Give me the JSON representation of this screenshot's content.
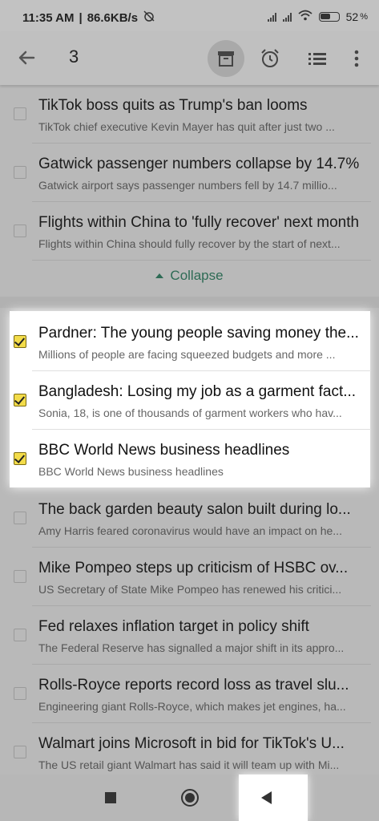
{
  "status": {
    "time": "11:35 AM",
    "speed": "86.6KB/s",
    "battery": "52"
  },
  "toolbar": {
    "count": "3"
  },
  "items": [
    {
      "title": "TikTok boss quits as Trump's ban looms",
      "subtitle": "TikTok chief executive Kevin Mayer has quit after just two ...",
      "checked": false
    },
    {
      "title": "Gatwick passenger numbers collapse by 14.7%",
      "subtitle": "Gatwick airport says passenger numbers fell by 14.7 millio...",
      "checked": false
    },
    {
      "title": "Flights within China to 'fully recover' next month",
      "subtitle": "Flights within China should fully recover by the start of next...",
      "checked": false
    },
    {
      "title": "Pardner: The young people saving money the...",
      "subtitle": "Millions of people are facing squeezed budgets and more ...",
      "checked": true
    },
    {
      "title": "Bangladesh: Losing my job as a garment fact...",
      "subtitle": "Sonia, 18, is one of thousands of garment workers who hav...",
      "checked": true
    },
    {
      "title": "BBC World News business headlines",
      "subtitle": "BBC World News business headlines",
      "checked": true
    },
    {
      "title": "The back garden beauty salon built during lo...",
      "subtitle": "Amy Harris feared coronavirus would have an impact on he...",
      "checked": false
    },
    {
      "title": "Mike Pompeo steps up criticism of HSBC ov...",
      "subtitle": "US Secretary of State Mike Pompeo has renewed his critici...",
      "checked": false
    },
    {
      "title": "Fed relaxes inflation target in policy shift",
      "subtitle": "The Federal Reserve has signalled a major shift in its appro...",
      "checked": false
    },
    {
      "title": "Rolls-Royce reports record loss as travel slu...",
      "subtitle": "Engineering giant Rolls-Royce, which makes jet engines, ha...",
      "checked": false
    },
    {
      "title": "Walmart joins Microsoft in bid for TikTok's U...",
      "subtitle": "The US retail giant Walmart has said it will team up with Mi...",
      "checked": false
    }
  ],
  "collapse_label": "Collapse"
}
